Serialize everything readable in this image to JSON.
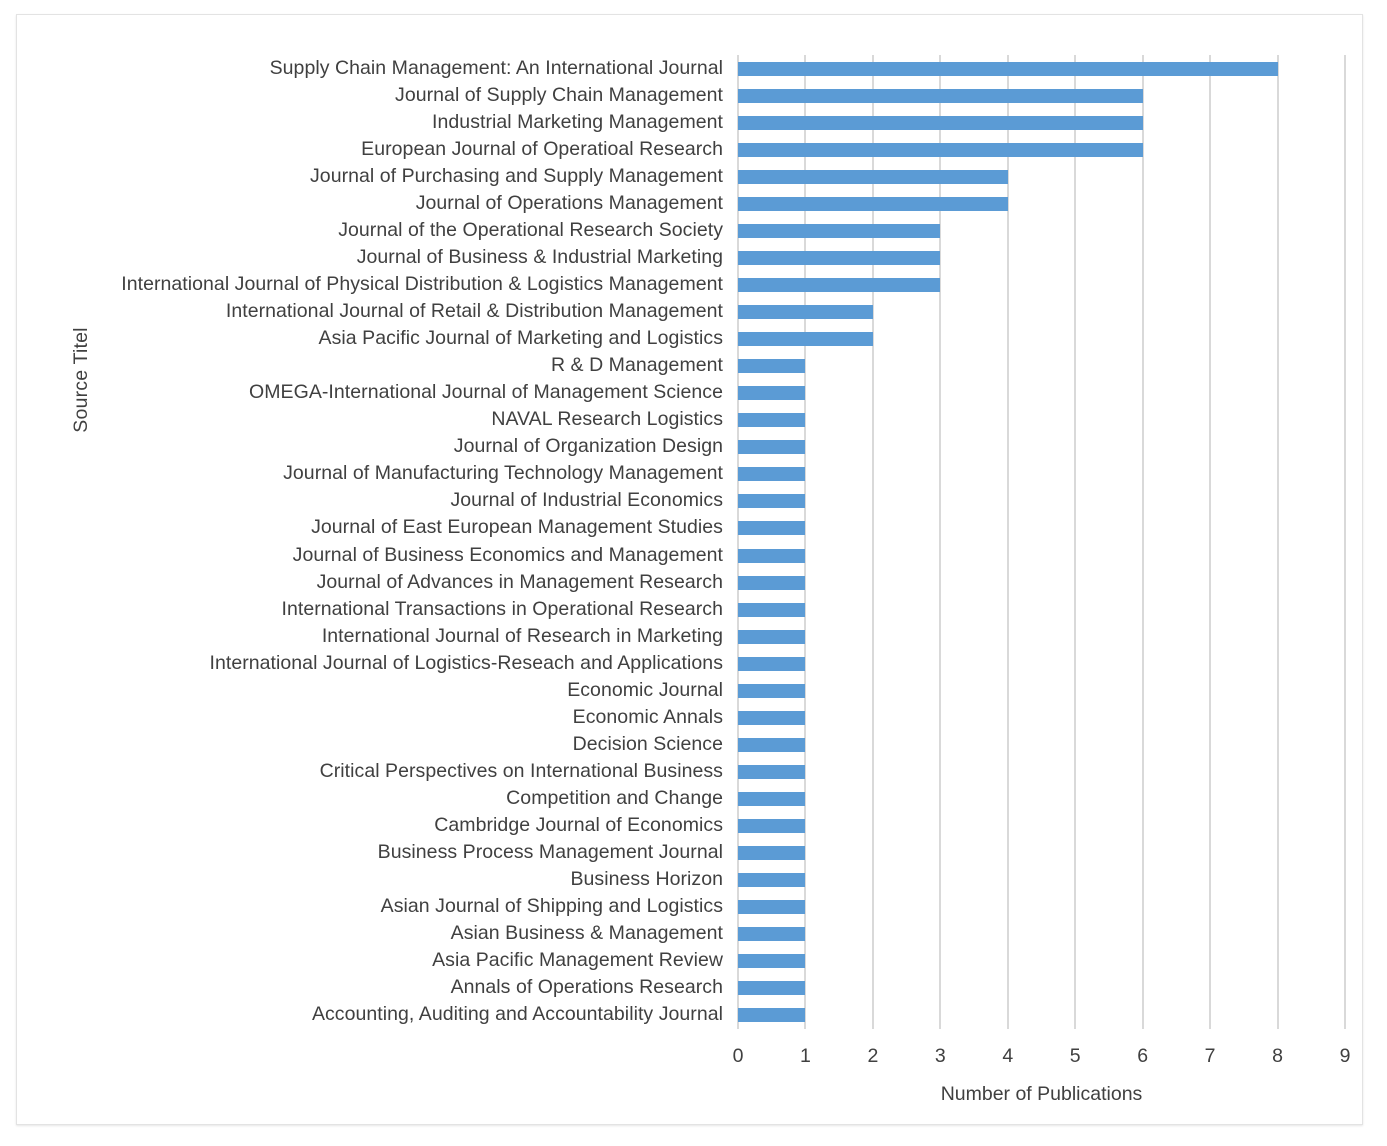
{
  "chart_data": {
    "type": "bar",
    "orientation": "horizontal",
    "title": "",
    "xlabel": "Number of Publications",
    "ylabel": "Source Titel",
    "xlim": [
      0,
      9
    ],
    "xticks": [
      "0",
      "1",
      "2",
      "3",
      "4",
      "5",
      "6",
      "7",
      "8",
      "9"
    ],
    "grid": "vertical",
    "legend": "none",
    "bar_color": "#5B9BD5",
    "text_color": "#404040",
    "gridline_color": "#D9D9D9",
    "categories": [
      "Supply Chain Management: An International Journal",
      "Journal of Supply Chain Management",
      "Industrial Marketing Management",
      "European Journal of Operatioal Research",
      "Journal of Purchasing and Supply Management",
      "Journal of Operations Management",
      "Journal of the Operational Research Society",
      "Journal of Business & Industrial Marketing",
      "International Journal of Physical Distribution & Logistics Management",
      "International Journal of Retail & Distribution Management",
      "Asia Pacific Journal of Marketing and Logistics",
      "R & D Management",
      "OMEGA-International Journal of Management Science",
      "NAVAL Research Logistics",
      "Journal of Organization Design",
      "Journal of Manufacturing Technology Management",
      "Journal of Industrial Economics",
      "Journal of East European Management Studies",
      "Journal of Business Economics and Management",
      "Journal of Advances in Management Research",
      "International Transactions in Operational Research",
      "International Journal of Research in Marketing",
      "International Journal of  Logistics-Reseach and Applications",
      "Economic Journal",
      "Economic Annals",
      "Decision Science",
      "Critical Perspectives on International Business",
      "Competition and Change",
      "Cambridge Journal of Economics",
      "Business Process Management Journal",
      "Business Horizon",
      "Asian Journal of Shipping and Logistics",
      "Asian Business & Management",
      "Asia Pacific Management Review",
      "Annals of Operations Research",
      "Accounting, Auditing and Accountability Journal"
    ],
    "values": [
      8,
      6,
      6,
      6,
      4,
      4,
      3,
      3,
      3,
      2,
      2,
      1,
      1,
      1,
      1,
      1,
      1,
      1,
      1,
      1,
      1,
      1,
      1,
      1,
      1,
      1,
      1,
      1,
      1,
      1,
      1,
      1,
      1,
      1,
      1,
      1
    ]
  }
}
